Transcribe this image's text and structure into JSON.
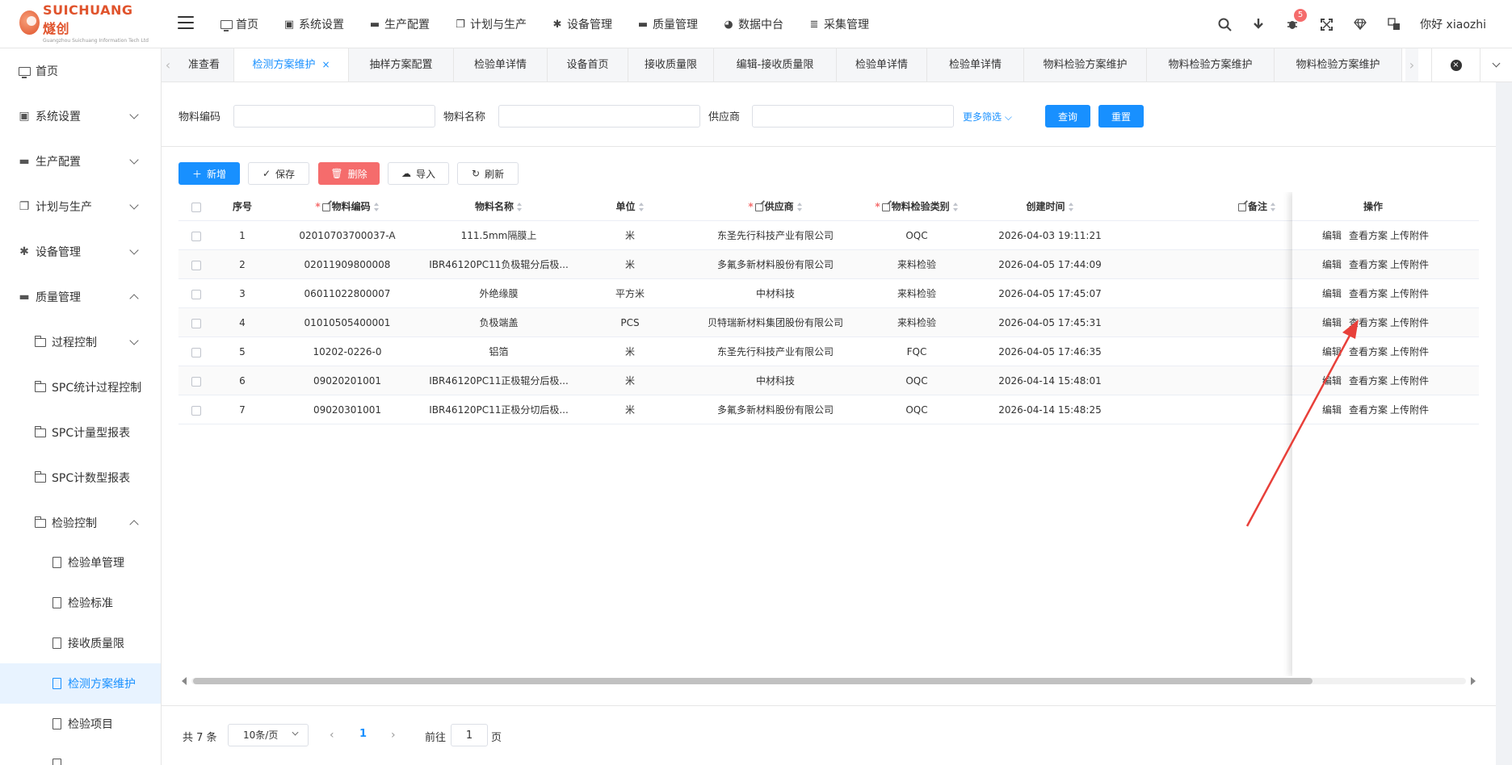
{
  "brand": {
    "name": "SUICHUANG 燧创",
    "sub": "Guangzhou Suichuang Information Tech Ltd"
  },
  "topnav": [
    {
      "label": "首页",
      "icon": "monitor-icon"
    },
    {
      "label": "系统设置",
      "icon": "id-card-icon"
    },
    {
      "label": "生产配置",
      "icon": "briefcase-icon"
    },
    {
      "label": "计划与生产",
      "icon": "windows-icon"
    },
    {
      "label": "设备管理",
      "icon": "asterisk-icon"
    },
    {
      "label": "质量管理",
      "icon": "briefcase-icon"
    },
    {
      "label": "数据中台",
      "icon": "pie-chart-icon"
    },
    {
      "label": "采集管理",
      "icon": "database-icon"
    }
  ],
  "header": {
    "bug_count": "5",
    "greeting": "你好 xiaozhi"
  },
  "sidebar": {
    "items": [
      {
        "label": "首页"
      },
      {
        "label": "系统设置"
      },
      {
        "label": "生产配置"
      },
      {
        "label": "计划与生产"
      },
      {
        "label": "设备管理"
      },
      {
        "label": "质量管理"
      },
      {
        "label": "过程控制"
      },
      {
        "label": "SPC统计过程控制"
      },
      {
        "label": "SPC计量型报表"
      },
      {
        "label": "SPC计数型报表"
      },
      {
        "label": "检验控制"
      },
      {
        "label": "检验单管理"
      },
      {
        "label": "检验标准"
      },
      {
        "label": "接收质量限"
      },
      {
        "label": "检测方案维护"
      },
      {
        "label": "检验项目"
      }
    ]
  },
  "tabs": [
    {
      "label": "准查看"
    },
    {
      "label": "检测方案维护"
    },
    {
      "label": "抽样方案配置"
    },
    {
      "label": "检验单详情"
    },
    {
      "label": "设备首页"
    },
    {
      "label": "接收质量限"
    },
    {
      "label": "编辑-接收质量限"
    },
    {
      "label": "检验单详情"
    },
    {
      "label": "检验单详情"
    },
    {
      "label": "物料检验方案维护"
    },
    {
      "label": "物料检验方案维护"
    },
    {
      "label": "物料检验方案维护"
    }
  ],
  "filters": {
    "material_code_label": "物料编码",
    "material_code_value": "",
    "material_name_label": "物料名称",
    "material_name_value": "",
    "supplier_label": "供应商",
    "supplier_value": "",
    "more_label": "更多筛选",
    "query_label": "查询",
    "reset_label": "重置"
  },
  "toolbar": {
    "add_label": "新增",
    "save_label": "保存",
    "delete_label": "删除",
    "import_label": "导入",
    "refresh_label": "刷新"
  },
  "table": {
    "headers": {
      "index": "序号",
      "code": "物料编码",
      "name": "物料名称",
      "unit": "单位",
      "supplier": "供应商",
      "category": "物料检验类别",
      "created": "创建时间",
      "remark": "备注",
      "ops": "操作"
    },
    "rows": [
      {
        "index": "1",
        "code": "02010703700037-A",
        "name": "111.5mm隔膜上",
        "unit": "米",
        "supplier": "东圣先行科技产业有限公司",
        "category": "OQC",
        "created": "2026-04-03 19:11:21",
        "remark": ""
      },
      {
        "index": "2",
        "code": "02011909800008",
        "name": "IBR46120PC11负极辊分后极...",
        "unit": "米",
        "supplier": "多氟多新材料股份有限公司",
        "category": "来料检验",
        "created": "2026-04-05 17:44:09",
        "remark": ""
      },
      {
        "index": "3",
        "code": "06011022800007",
        "name": "外绝缘膜",
        "unit": "平方米",
        "supplier": "中材科技",
        "category": "来料检验",
        "created": "2026-04-05 17:45:07",
        "remark": ""
      },
      {
        "index": "4",
        "code": "01010505400001",
        "name": "负极端盖",
        "unit": "PCS",
        "supplier": "贝特瑞新材料集团股份有限公司",
        "category": "来料检验",
        "created": "2026-04-05 17:45:31",
        "remark": ""
      },
      {
        "index": "5",
        "code": "10202-0226-0",
        "name": "铝箔",
        "unit": "米",
        "supplier": "东圣先行科技产业有限公司",
        "category": "FQC",
        "created": "2026-04-05 17:46:35",
        "remark": ""
      },
      {
        "index": "6",
        "code": "09020201001",
        "name": "IBR46120PC11正极辊分后极...",
        "unit": "米",
        "supplier": "中材科技",
        "category": "OQC",
        "created": "2026-04-14 15:48:01",
        "remark": ""
      },
      {
        "index": "7",
        "code": "09020301001",
        "name": "IBR46120PC11正极分切后极...",
        "unit": "米",
        "supplier": "多氟多新材料股份有限公司",
        "category": "OQC",
        "created": "2026-04-14 15:48:25",
        "remark": ""
      }
    ],
    "ops": {
      "edit": "编辑",
      "view": "查看方案",
      "upload": "上传附件"
    }
  },
  "pagination": {
    "total": "共 7 条",
    "page_size": "10条/页",
    "current": "1",
    "goto_prefix": "前往",
    "goto_value": "1",
    "goto_suffix": "页"
  },
  "colors": {
    "accent": "#1890ff",
    "danger": "#f56c6c",
    "annotation": "#e8403a"
  }
}
